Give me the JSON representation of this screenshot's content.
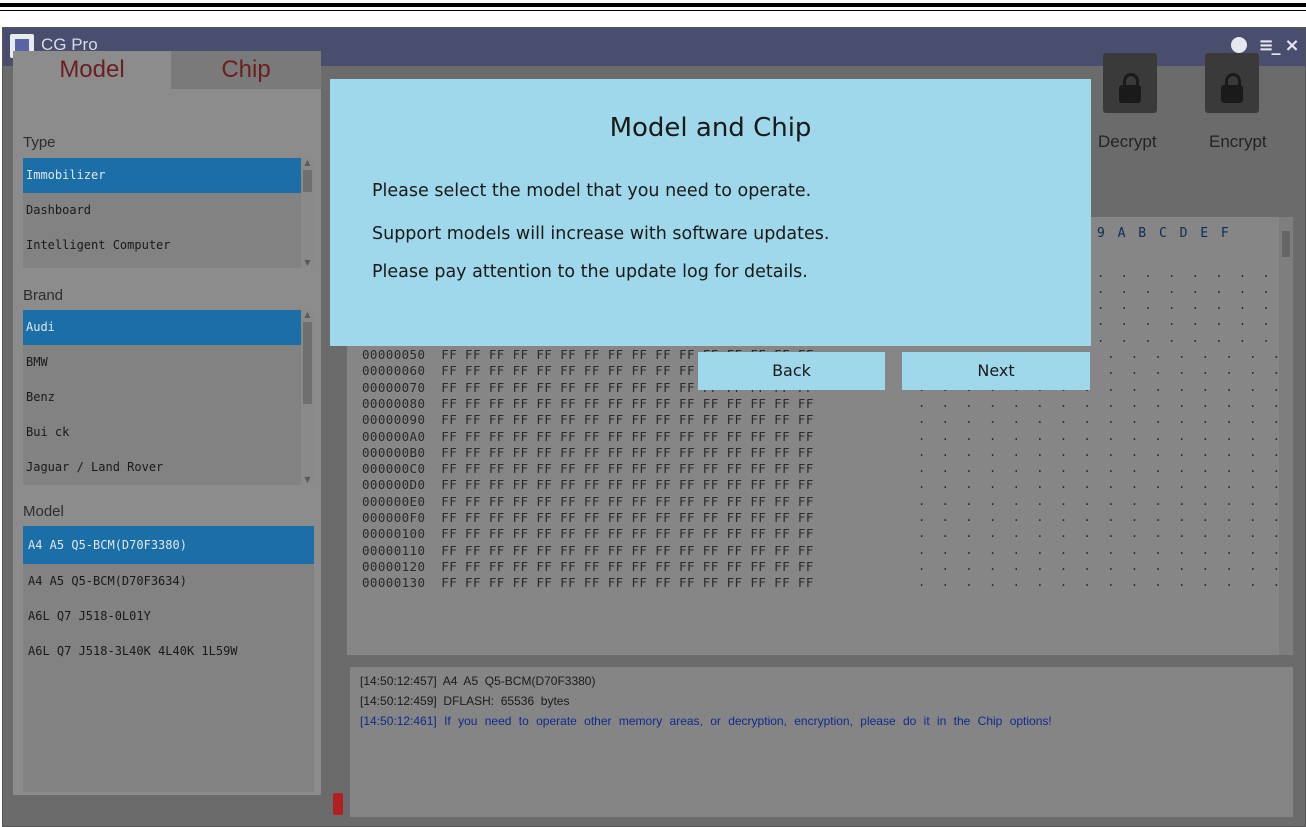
{
  "app": {
    "title": "CG Pro",
    "icon": "chip-app-icon"
  },
  "titlebar": {
    "user_icon": "user-icon",
    "menu_label": "≡",
    "minimize_label": "_",
    "close_label": "×"
  },
  "tabs": [
    {
      "label": "Model"
    },
    {
      "label": "Chip"
    }
  ],
  "type_section": {
    "label": "Type",
    "items": [
      "Immobilizer",
      "Dashboard",
      "Intelligent Computer"
    ],
    "selected": "Immobilizer"
  },
  "brand_section": {
    "label": "Brand",
    "items": [
      "Audi",
      "BMW",
      "Benz",
      "Bui ck",
      "Jaguar / Land Rover"
    ],
    "selected": "Audi"
  },
  "model_section": {
    "label": "Model",
    "items": [
      "A4 A5 Q5-BCM(D70F3380)",
      "A4 A5 Q5-BCM(D70F3634)",
      "A6L Q7 J518-0L01Y",
      "A6L Q7 J518-3L40K 4L40K 1L59W"
    ],
    "selected": "A4 A5 Q5-BCM(D70F3380)"
  },
  "toolbar": {
    "decrypt_label": "Decrypt",
    "encrypt_label": "Encrypt"
  },
  "hex": {
    "header": "9 A B C D E F",
    "rows": [
      {
        "addr": "00000050",
        "bytes": "FF FF FF FF FF FF FF FF FF FF FF FF FF FF FF FF"
      },
      {
        "addr": "00000060",
        "bytes": "FF FF FF FF FF FF FF FF FF FF FF FF FF FF FF FF"
      },
      {
        "addr": "00000070",
        "bytes": "FF FF FF FF FF FF FF FF FF FF FF FF FF FF FF FF"
      },
      {
        "addr": "00000080",
        "bytes": "FF FF FF FF FF FF FF FF FF FF FF FF FF FF FF FF"
      },
      {
        "addr": "00000090",
        "bytes": "FF FF FF FF FF FF FF FF FF FF FF FF FF FF FF FF"
      },
      {
        "addr": "000000A0",
        "bytes": "FF FF FF FF FF FF FF FF FF FF FF FF FF FF FF FF"
      },
      {
        "addr": "000000B0",
        "bytes": "FF FF FF FF FF FF FF FF FF FF FF FF FF FF FF FF"
      },
      {
        "addr": "000000C0",
        "bytes": "FF FF FF FF FF FF FF FF FF FF FF FF FF FF FF FF"
      },
      {
        "addr": "000000D0",
        "bytes": "FF FF FF FF FF FF FF FF FF FF FF FF FF FF FF FF"
      },
      {
        "addr": "000000E0",
        "bytes": "FF FF FF FF FF FF FF FF FF FF FF FF FF FF FF FF"
      },
      {
        "addr": "000000F0",
        "bytes": "FF FF FF FF FF FF FF FF FF FF FF FF FF FF FF FF"
      },
      {
        "addr": "00000100",
        "bytes": "FF FF FF FF FF FF FF FF FF FF FF FF FF FF FF FF"
      },
      {
        "addr": "00000110",
        "bytes": "FF FF FF FF FF FF FF FF FF FF FF FF FF FF FF FF"
      },
      {
        "addr": "00000120",
        "bytes": "FF FF FF FF FF FF FF FF FF FF FF FF FF FF FF FF"
      },
      {
        "addr": "00000130",
        "bytes": "FF FF FF FF FF FF FF FF FF FF FF FF FF FF FF FF"
      }
    ],
    "ascii": ". . . . . . . . . . . . . . . ."
  },
  "log": [
    {
      "time": "[14:50:12:457]",
      "text": "A4  A5  Q5-BCM(D70F3380)"
    },
    {
      "time": "[14:50:12:459]",
      "text": "DFLASH:  65536  bytes"
    },
    {
      "time": "[14:50:12:461]",
      "text": "If you need to operate other memory areas, or decryption, encryption, please do it in the Chip options!"
    }
  ],
  "dialog": {
    "title": "Model and Chip",
    "lines": [
      "Please select the model that you need to operate.",
      "Support models will increase with software updates.",
      "Please pay attention to the update log for details."
    ],
    "back_label": "Back",
    "next_label": "Next"
  },
  "colors": {
    "dialog_bg": "#9ed8ea",
    "selected_bg": "#1c6fa6",
    "titlebar_bg": "#4a4e6e",
    "tab_text": "#6b2020",
    "log_blue": "#102a8c"
  }
}
